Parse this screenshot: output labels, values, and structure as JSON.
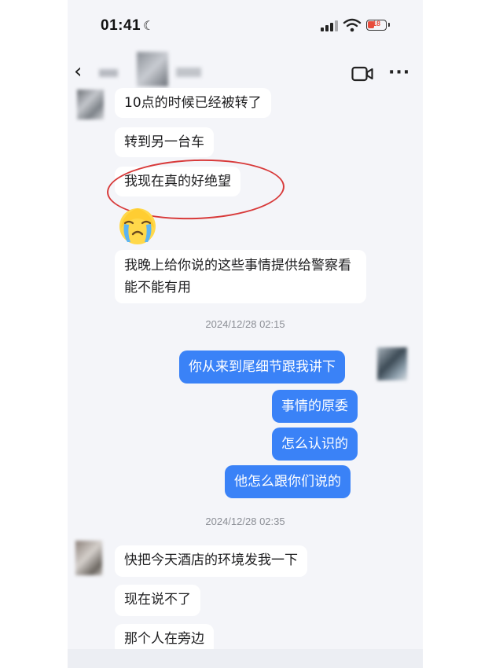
{
  "status_bar": {
    "time": "01:41",
    "battery_level": "18"
  },
  "nav": {
    "back": "‹",
    "more": "···"
  },
  "messages": [
    {
      "id": "m1",
      "side": "in",
      "text": "10点的时候已经被转了"
    },
    {
      "id": "m2",
      "side": "in",
      "text": "转到另一台车"
    },
    {
      "id": "m3",
      "side": "in",
      "text": "我现在真的好绝望",
      "highlighted": true
    },
    {
      "id": "m4",
      "side": "in",
      "type": "sticker",
      "icon": "crying-face-emoji"
    },
    {
      "id": "m5",
      "side": "in",
      "text": "我晚上给你说的这些事情提供给警察看能不能有用"
    },
    {
      "id": "ts1",
      "type": "timestamp",
      "text": "2024/12/28 02:15"
    },
    {
      "id": "m6",
      "side": "out",
      "text": "你从来到尾细节跟我讲下"
    },
    {
      "id": "m7",
      "side": "out",
      "text": "事情的原委"
    },
    {
      "id": "m8",
      "side": "out",
      "text": "怎么认识的"
    },
    {
      "id": "m9",
      "side": "out",
      "text": "他怎么跟你们说的"
    },
    {
      "id": "ts2",
      "type": "timestamp",
      "text": "2024/12/28 02:35"
    },
    {
      "id": "m10",
      "side": "in",
      "text": "快把今天酒店的环境发我一下"
    },
    {
      "id": "m11",
      "side": "in",
      "text": "现在说不了"
    },
    {
      "id": "m12",
      "side": "in",
      "text": "那个人在旁边"
    }
  ],
  "colors": {
    "outgoing_bubble": "#3a82f7",
    "incoming_bubble": "#ffffff",
    "background": "#f4f5f9",
    "highlight_ellipse": "#d83a3a"
  }
}
